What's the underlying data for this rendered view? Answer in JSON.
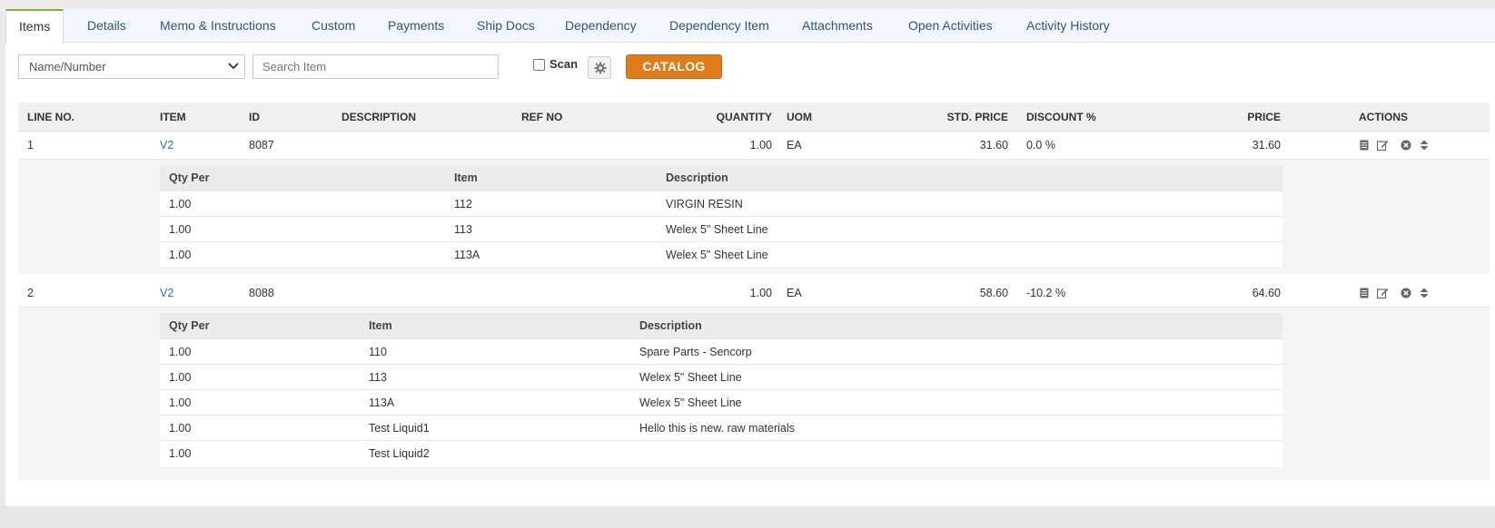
{
  "tabs": [
    {
      "label": "Items",
      "active": true
    },
    {
      "label": "Details"
    },
    {
      "label": "Memo & Instructions"
    },
    {
      "label": "Custom"
    },
    {
      "label": "Payments"
    },
    {
      "label": "Ship Docs"
    },
    {
      "label": "Dependency"
    },
    {
      "label": "Dependency Item"
    },
    {
      "label": "Attachments"
    },
    {
      "label": "Open Activities"
    },
    {
      "label": "Activity History"
    }
  ],
  "toolbar": {
    "search_by_selected": "Name/Number",
    "search_placeholder": "Search Item",
    "scan_label": "Scan",
    "scan_checked": false,
    "catalog_label": "CATALOG",
    "accent_color": "#e07d1a"
  },
  "table": {
    "headers": {
      "line_no": "LINE NO.",
      "item": "ITEM",
      "id": "ID",
      "description": "DESCRIPTION",
      "ref_no": "REF NO",
      "quantity": "QUANTITY",
      "uom": "UOM",
      "std_price": "STD. PRICE",
      "discount": "DISCOUNT %",
      "price": "PRICE",
      "actions": "ACTIONS"
    },
    "rows": [
      {
        "line_no": "1",
        "item": "V2",
        "id": "8087",
        "description": "",
        "ref_no": "",
        "quantity": "1.00",
        "uom": "EA",
        "std_price": "31.60",
        "discount": "0.0 %",
        "price": "31.60",
        "components": {
          "headers": {
            "qty_per": "Qty Per",
            "item": "Item",
            "description": "Description"
          },
          "rows": [
            {
              "qty_per": "1.00",
              "item": "112",
              "description": "VIRGIN RESIN"
            },
            {
              "qty_per": "1.00",
              "item": "113",
              "description": "Welex 5\" Sheet Line"
            },
            {
              "qty_per": "1.00",
              "item": "113A",
              "description": "Welex 5\" Sheet Line"
            }
          ]
        }
      },
      {
        "line_no": "2",
        "item": "V2",
        "id": "8088",
        "description": "",
        "ref_no": "",
        "quantity": "1.00",
        "uom": "EA",
        "std_price": "58.60",
        "discount": "-10.2 %",
        "price": "64.60",
        "components": {
          "headers": {
            "qty_per": "Qty Per",
            "item": "Item",
            "description": "Description"
          },
          "rows": [
            {
              "qty_per": "1.00",
              "item": "110",
              "description": "Spare Parts - Sencorp"
            },
            {
              "qty_per": "1.00",
              "item": "113",
              "description": "Welex 5\" Sheet Line"
            },
            {
              "qty_per": "1.00",
              "item": "113A",
              "description": "Welex 5\" Sheet Line"
            },
            {
              "qty_per": "1.00",
              "item": "Test Liquid1",
              "description": "Hello this is new. raw materials"
            },
            {
              "qty_per": "1.00",
              "item": "Test Liquid2",
              "description": ""
            }
          ]
        }
      }
    ]
  }
}
